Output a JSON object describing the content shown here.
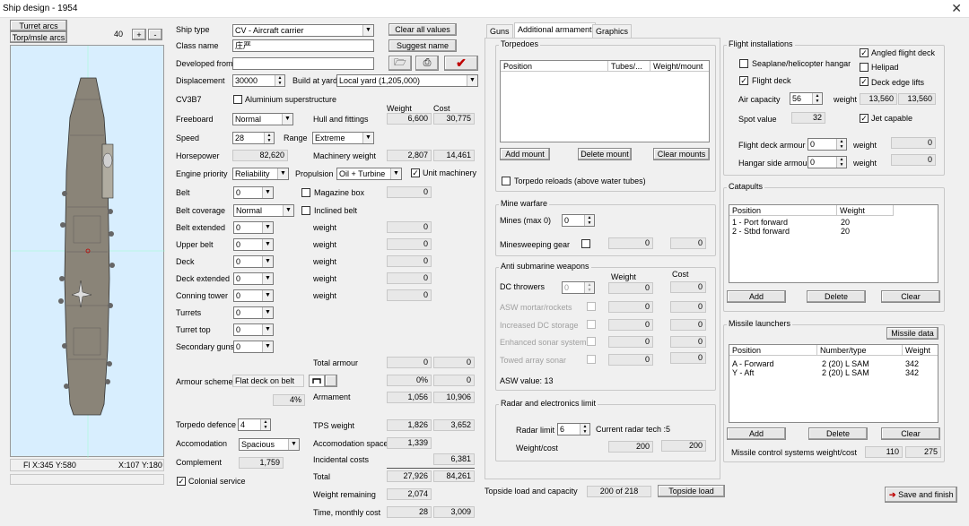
{
  "window": {
    "title": "Ship design - 1954",
    "close": "✕"
  },
  "left": {
    "turret_arcs": "Turret arcs",
    "torp_arcs": "Torp/msle arcs",
    "zoom": "40",
    "plus": "+",
    "minus": "-",
    "status_fl": "Fl X:345 Y:580",
    "status_xy": "X:107 Y:180"
  },
  "form": {
    "ship_type_l": "Ship type",
    "ship_type": "CV - Aircraft carrier",
    "class_name_l": "Class name",
    "class_name": "庄严",
    "developed_l": "Developed from",
    "developed": "",
    "displacement_l": "Displacement",
    "displacement": "30000",
    "build_l": "Build at yard",
    "build": "Local yard (1,205,000)",
    "code": "CV3B7",
    "alu": "Aluminium superstructure",
    "clear_all": "Clear all values",
    "suggest": "Suggest name",
    "weight_h": "Weight",
    "cost_h": "Cost",
    "freeboard_l": "Freeboard",
    "freeboard": "Normal",
    "hull_l": "Hull and fittings",
    "hull_w": "6,600",
    "hull_c": "30,775",
    "speed_l": "Speed",
    "speed": "28",
    "range_l": "Range",
    "range": "Extreme",
    "hp_l": "Horsepower",
    "hp": "82,620",
    "mach_l": "Machinery weight",
    "mach_w": "2,807",
    "mach_c": "14,461",
    "engine_l": "Engine priority",
    "engine": "Reliability",
    "prop_l": "Propulsion",
    "prop": "Oil + Turbine",
    "unit_mach": "Unit machinery",
    "belt_l": "Belt",
    "belt": "0",
    "magbox": "Magazine box",
    "magbox_v": "0",
    "beltcov_l": "Belt coverage",
    "beltcov": "Normal",
    "inclined": "Inclined belt",
    "beltext_l": "Belt extended",
    "beltext": "0",
    "upbelt_l": "Upper belt",
    "upbelt": "0",
    "deck_l": "Deck",
    "deck": "0",
    "deckext_l": "Deck extended",
    "deckext": "0",
    "conning_l": "Conning tower",
    "conning": "0",
    "turrets_l": "Turrets",
    "turrets": "0",
    "turtop_l": "Turret top",
    "turtop": "0",
    "secgun_l": "Secondary guns",
    "secgun": "0",
    "weight_l": "weight",
    "zero": "0",
    "totarm_l": "Total armour",
    "totarm_w": "0",
    "totarm_c": "0",
    "armscheme_l": "Armour scheme",
    "armscheme": "Flat deck on belt",
    "pct0": "0%",
    "pct4": "4%",
    "arm_l": "Armament",
    "arm_w": "1,056",
    "arm_c": "10,906",
    "torpdef_l": "Torpedo defence",
    "torpdef": "4",
    "tps_l": "TPS weight",
    "tps_w": "1,826",
    "tps_c": "3,652",
    "accom_l": "Accomodation",
    "accom": "Spacious",
    "accsp_l": "Accomodation space",
    "accsp": "1,339",
    "compl_l": "Complement",
    "compl": "1,759",
    "incid_l": "Incidental costs",
    "incid": "6,381",
    "total_l": "Total",
    "total_w": "27,926",
    "total_c": "84,261",
    "colonial": "Colonial service",
    "wrem_l": "Weight remaining",
    "wrem": "2,074",
    "time_l": "Time, monthly cost",
    "time": "28",
    "monthly": "3,009"
  },
  "tabs": [
    "Guns",
    "Additional armament",
    "Graphics"
  ],
  "torp": {
    "title": "Torpedoes",
    "cols": [
      "Position",
      "Tubes/...",
      "Weight/mount"
    ],
    "add": "Add mount",
    "delete": "Delete mount",
    "clear": "Clear mounts",
    "reloads": "Torpedo reloads (above water tubes)"
  },
  "mine": {
    "title": "Mine warfare",
    "mines_l": "Mines (max 0)",
    "mines": "0",
    "sweep_l": "Minesweeping gear",
    "v1": "0",
    "v2": "0"
  },
  "asw": {
    "title": "Anti submarine weapons",
    "weight_h": "Weight",
    "cost_h": "Cost",
    "rows": [
      {
        "label": "DC throwers",
        "w": "0",
        "c": "0"
      },
      {
        "label": "ASW mortar/rockets",
        "w": "0",
        "c": "0"
      },
      {
        "label": "Increased DC storage",
        "w": "0",
        "c": "0"
      },
      {
        "label": "Enhanced sonar system",
        "w": "0",
        "c": "0"
      },
      {
        "label": "Towed array sonar",
        "w": "0",
        "c": "0"
      }
    ],
    "dc": "0",
    "value": "ASW value: 13"
  },
  "radar": {
    "title": "Radar and electronics limit",
    "limit_l": "Radar limit",
    "limit": "6",
    "tech": "Current radar tech :5",
    "wc_l": "Weight/cost",
    "w": "200",
    "c": "200"
  },
  "topside": {
    "label": "Topside load and capacity",
    "value": "200 of 218",
    "button": "Topside load"
  },
  "flight": {
    "title": "Flight installations",
    "seaplane": "Seaplane/helicopter hangar",
    "angled": "Angled flight deck",
    "helipad": "Helipad",
    "flightdeck": "Flight deck",
    "edgelifts": "Deck edge lifts",
    "aircap_l": "Air capacity",
    "aircap": "56",
    "weight_l": "weight",
    "w1": "13,560",
    "w2": "13,560",
    "spot_l": "Spot value",
    "spot": "32",
    "jet": "Jet capable",
    "fdarm_l": "Flight deck armour",
    "fdarm": "0",
    "fdarm_w": "0",
    "hangar_l": "Hangar side armour",
    "hangar": "0",
    "hangar_w": "0"
  },
  "catapults": {
    "title": "Catapults",
    "cols": [
      "Position",
      "Weight"
    ],
    "rows": [
      {
        "pos": "1 - Port forward",
        "w": "20"
      },
      {
        "pos": "2 - Stbd forward",
        "w": "20"
      }
    ],
    "add": "Add",
    "delete": "Delete",
    "clear": "Clear"
  },
  "missiles": {
    "title": "Missile launchers",
    "data": "Missile data",
    "cols": [
      "Position",
      "Number/type",
      "Weight"
    ],
    "rows": [
      {
        "pos": "A - Forward",
        "type": "2 (20) L SAM",
        "w": "342"
      },
      {
        "pos": "Y - Aft",
        "type": "2 (20) L SAM",
        "w": "342"
      }
    ],
    "add": "Add",
    "delete": "Delete",
    "clear": "Clear",
    "ctrl_l": "Missile control systems weight/cost",
    "ctrl_w": "110",
    "ctrl_c": "275"
  },
  "save": "Save and finish",
  "colors": {
    "ship": "#8a8478",
    "water": "#d8eefe",
    "accent": "#c00000"
  }
}
